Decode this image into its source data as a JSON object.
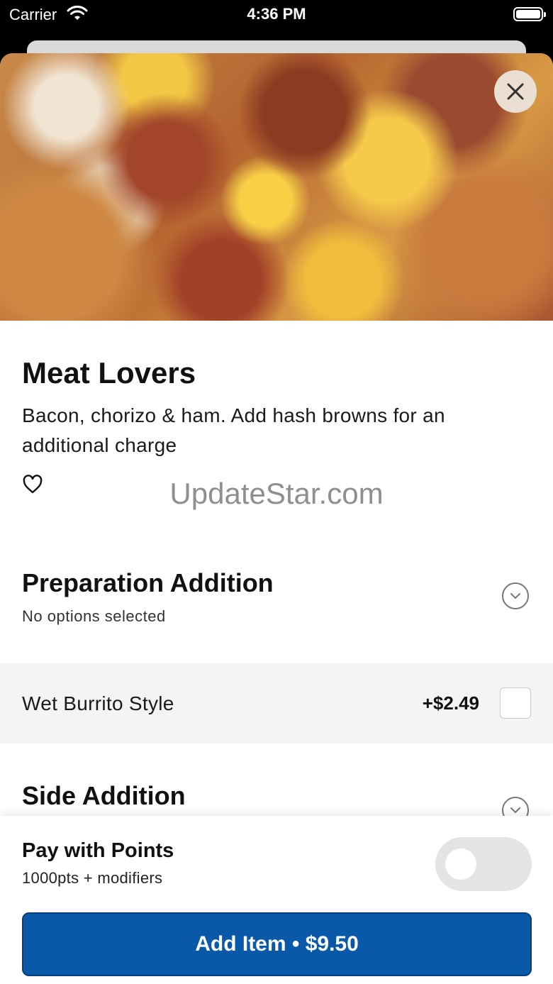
{
  "status_bar": {
    "carrier": "Carrier",
    "time": "4:36 PM"
  },
  "item": {
    "name": "Meat Lovers",
    "description": "Bacon, chorizo & ham. Add hash browns for an additional charge"
  },
  "watermark": "UpdateStar.com",
  "sections": [
    {
      "title": "Preparation Addition",
      "subtitle": "No options selected"
    },
    {
      "title": "Side Addition"
    }
  ],
  "options": [
    {
      "label": "Wet Burrito Style",
      "price": "+$2.49",
      "checked": false
    }
  ],
  "pay_with_points": {
    "title": "Pay with Points",
    "subtitle": "1000pts + modifiers",
    "enabled": false
  },
  "add_button": {
    "label": "Add Item • $9.50"
  },
  "colors": {
    "primary": "#0a59a8",
    "toggle_off": "#e4e4e4",
    "option_bg": "#f4f4f4"
  }
}
